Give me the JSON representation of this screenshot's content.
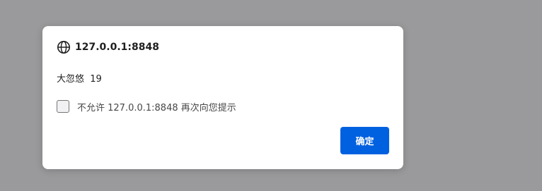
{
  "dialog": {
    "origin": "127.0.0.1:8848",
    "origin_icon": "globe-icon",
    "message": "大忽悠  19",
    "checkbox_label": "不允许 127.0.0.1:8848 再次向您提示",
    "checkbox_checked": false,
    "ok_label": "确定"
  },
  "colors": {
    "backdrop": "#9a999b",
    "dialog_bg": "#ffffff",
    "primary_button": "#0061e0"
  }
}
